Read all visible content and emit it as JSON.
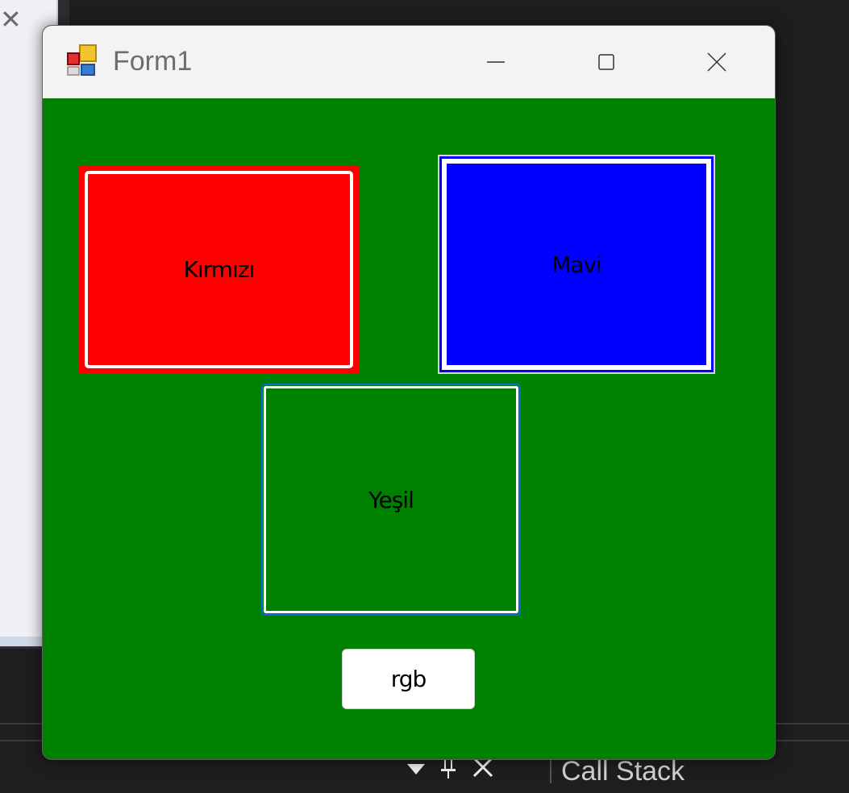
{
  "window": {
    "title": "Form1",
    "background_color": "#008000"
  },
  "boxes": {
    "red": {
      "label": "Kırmızı",
      "color": "#ff0000"
    },
    "blue": {
      "label": "Mavi",
      "color": "#0000ff"
    },
    "green": {
      "label": "Yeşil",
      "color": "#008000"
    }
  },
  "button": {
    "label": "rgb"
  },
  "ide": {
    "panel_label": "Call Stack"
  }
}
